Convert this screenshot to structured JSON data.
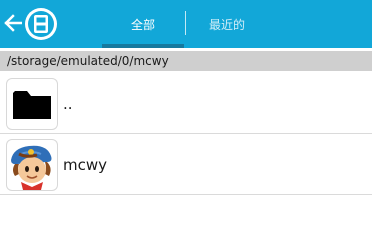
{
  "header": {
    "tabs": [
      {
        "label": "全部",
        "selected": true
      },
      {
        "label": "最近的",
        "selected": false
      }
    ],
    "accent_color": "#12a7d8",
    "indicator_color": "#16799e"
  },
  "path": {
    "text": "/storage/emulated/0/mcwy"
  },
  "files": [
    {
      "name": "..",
      "icon": "folder-icon"
    },
    {
      "name": "mcwy",
      "icon": "cowboy-character-icon"
    }
  ]
}
